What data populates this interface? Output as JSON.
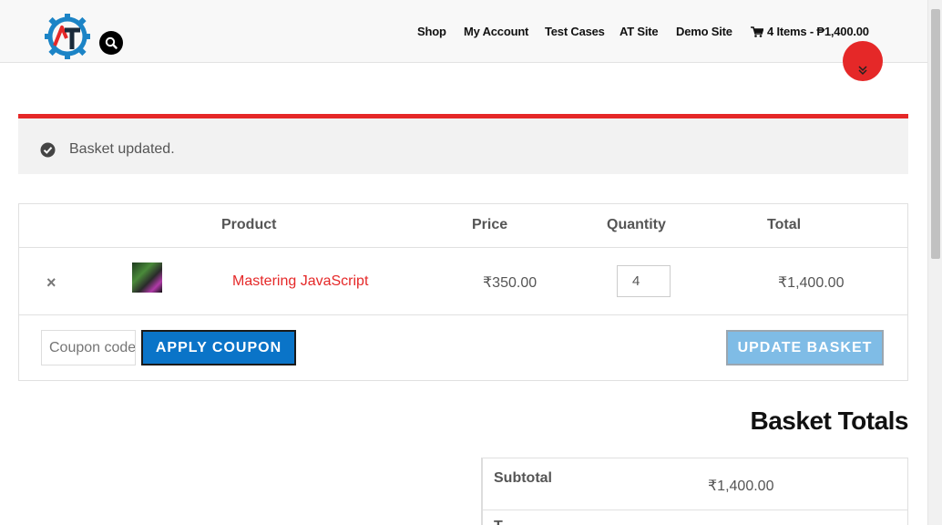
{
  "header": {
    "nav": {
      "shop": "Shop",
      "my_account": "My Account",
      "test_cases": "Test Cases",
      "at_site": "AT Site",
      "demo_site": "Demo Site",
      "cart": "4 Items - ₱1,400.00"
    },
    "logo_icon": "gear-logo-icon",
    "search_icon": "search-icon"
  },
  "notice": {
    "icon": "check-circle-icon",
    "text": "Basket updated."
  },
  "cart_table": {
    "headers": {
      "product": "Product",
      "price": "Price",
      "quantity": "Quantity",
      "total": "Total"
    },
    "rows": [
      {
        "remove": "×",
        "product": "Mastering JavaScript",
        "price": "₹350.00",
        "quantity": "4",
        "total": "₹1,400.00"
      }
    ],
    "coupon_placeholder": "Coupon code",
    "apply_label": "APPLY COUPON",
    "update_label": "UPDATE BASKET"
  },
  "totals": {
    "title": "Basket Totals",
    "subtotal_label": "Subtotal",
    "subtotal_value": "₹1,400.00",
    "next_label": "T"
  },
  "colors": {
    "accent_red": "#e52828",
    "button_blue": "#0a74c8",
    "disabled_blue": "#7fbce6"
  }
}
